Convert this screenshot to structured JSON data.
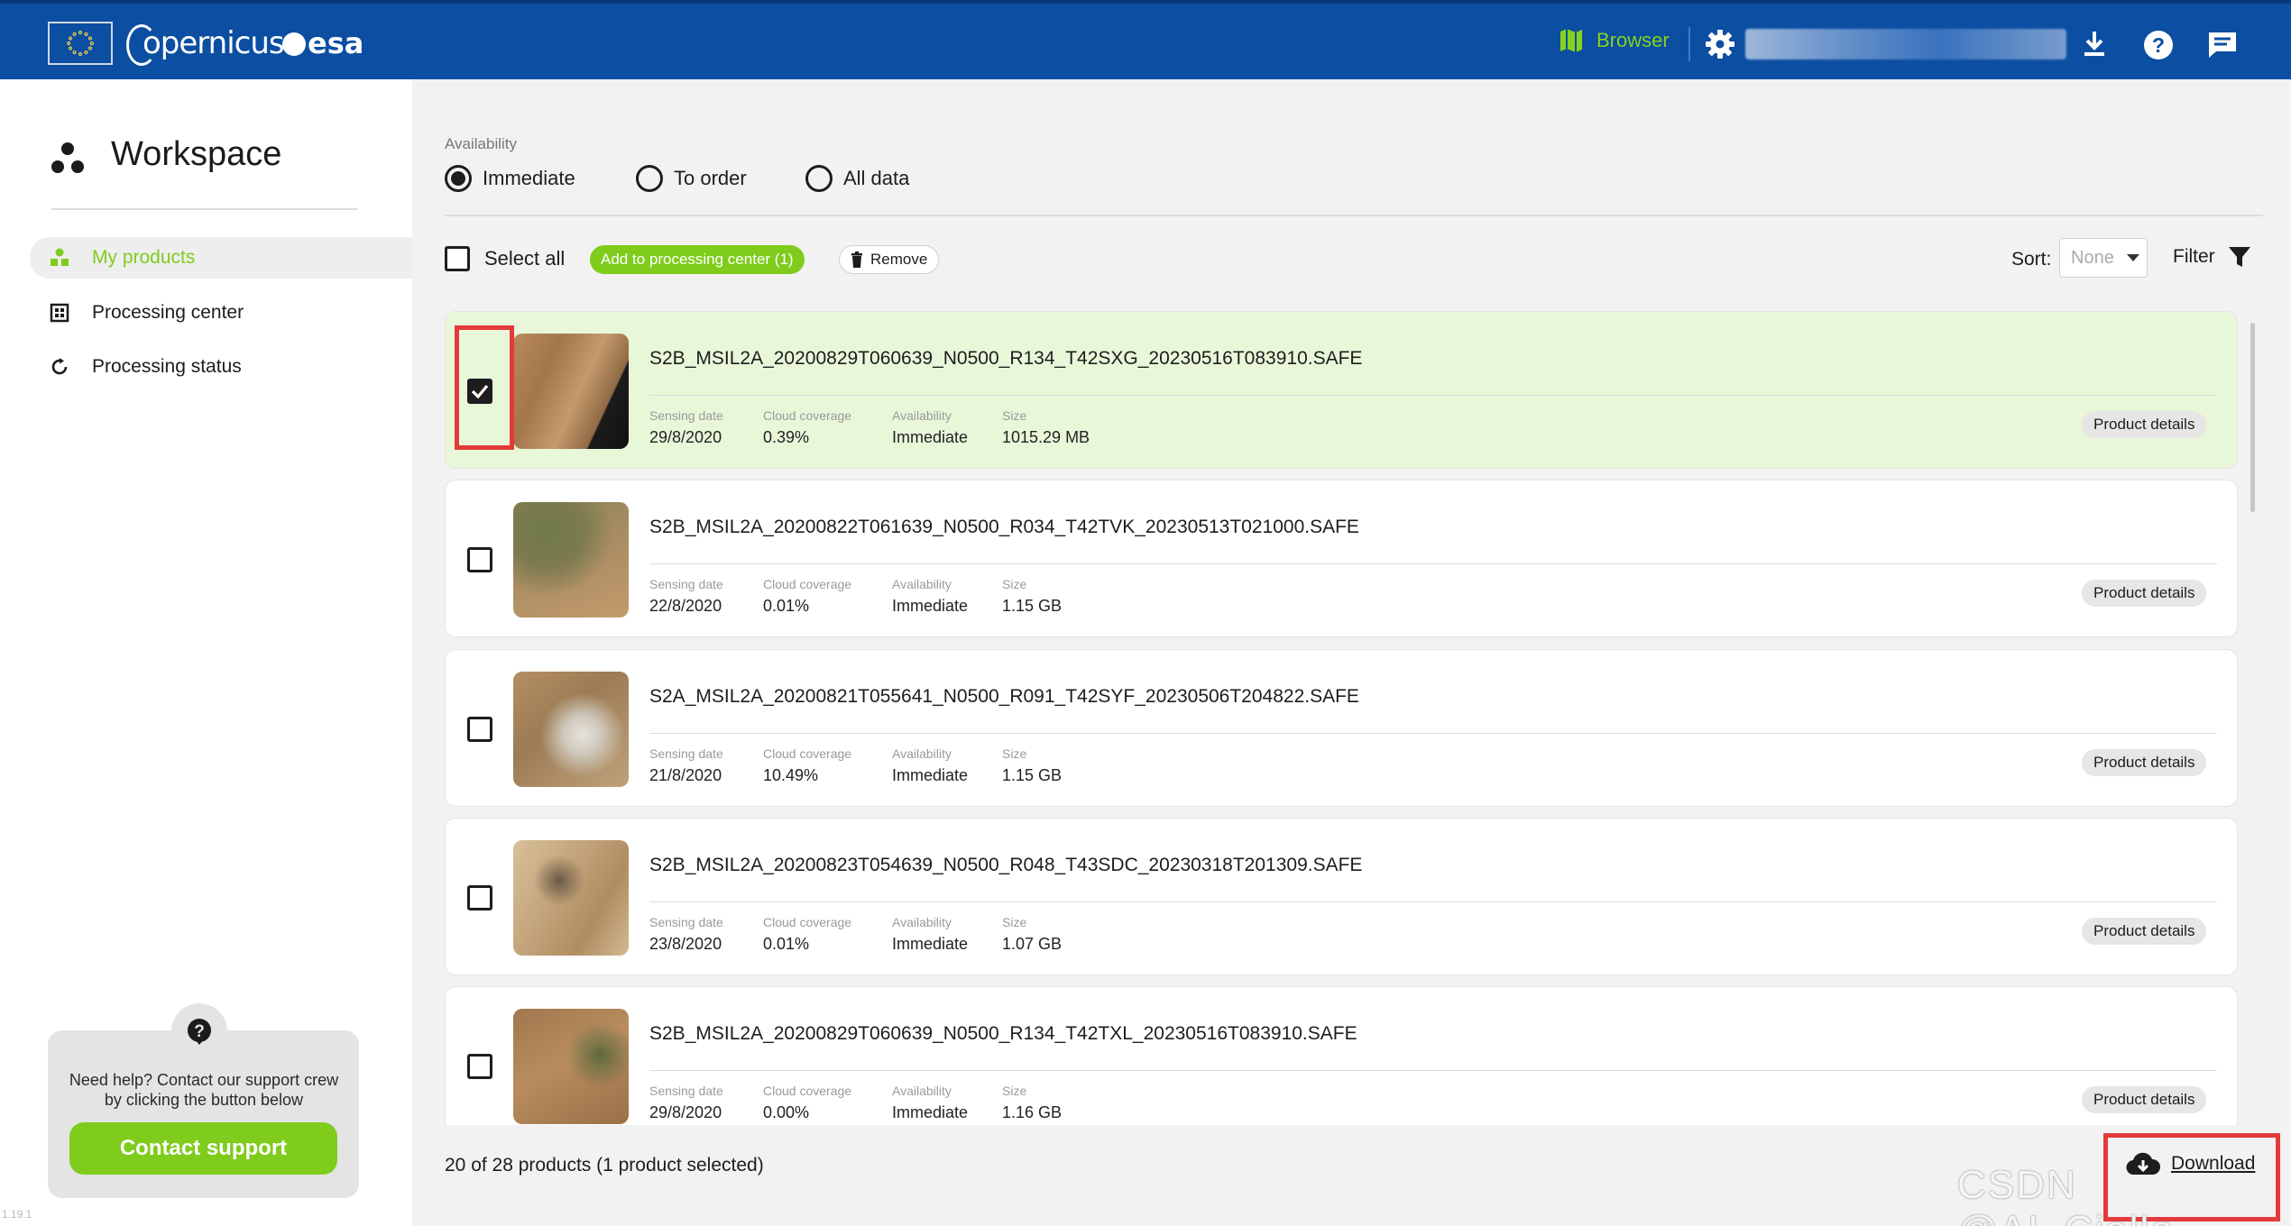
{
  "header": {
    "brand_copernicus": "opernicus",
    "brand_esa": "esa",
    "browser_label": "Browser",
    "accent": "#86d21c",
    "bar_color": "#0b4ea2"
  },
  "sidebar": {
    "title": "Workspace",
    "items": [
      {
        "label": "My products",
        "icon": "products-icon",
        "active": true
      },
      {
        "label": "Processing center",
        "icon": "processing-center-icon",
        "active": false
      },
      {
        "label": "Processing status",
        "icon": "refresh-icon",
        "active": false
      }
    ],
    "help_text": "Need help? Contact our support crew by clicking the button below",
    "contact_label": "Contact support",
    "version": "1.19.1"
  },
  "availability": {
    "label": "Availability",
    "options": [
      "Immediate",
      "To order",
      "All data"
    ],
    "selected": "Immediate"
  },
  "toolbar": {
    "select_all": "Select all",
    "add_processing": "Add to processing center (1)",
    "remove": "Remove",
    "sort_label": "Sort:",
    "sort_value": "None",
    "filter": "Filter"
  },
  "meta_labels": {
    "sensing": "Sensing date",
    "cloud": "Cloud coverage",
    "availability": "Availability",
    "size": "Size",
    "details": "Product details"
  },
  "products": [
    {
      "name": "S2B_MSIL2A_20200829T060639_N0500_R134_T42SXG_20230516T083910.SAFE",
      "sensing_date": "29/8/2020",
      "cloud": "0.39%",
      "availability": "Immediate",
      "size": "1015.29 MB",
      "selected": true
    },
    {
      "name": "S2B_MSIL2A_20200822T061639_N0500_R034_T42TVK_20230513T021000.SAFE",
      "sensing_date": "22/8/2020",
      "cloud": "0.01%",
      "availability": "Immediate",
      "size": "1.15 GB",
      "selected": false
    },
    {
      "name": "S2A_MSIL2A_20200821T055641_N0500_R091_T42SYF_20230506T204822.SAFE",
      "sensing_date": "21/8/2020",
      "cloud": "10.49%",
      "availability": "Immediate",
      "size": "1.15 GB",
      "selected": false
    },
    {
      "name": "S2B_MSIL2A_20200823T054639_N0500_R048_T43SDC_20230318T201309.SAFE",
      "sensing_date": "23/8/2020",
      "cloud": "0.01%",
      "availability": "Immediate",
      "size": "1.07 GB",
      "selected": false
    },
    {
      "name": "S2B_MSIL2A_20200829T060639_N0500_R134_T42TXL_20230516T083910.SAFE",
      "sensing_date": "29/8/2020",
      "cloud": "0.00%",
      "availability": "Immediate",
      "size": "1.16 GB",
      "selected": false
    }
  ],
  "footer": {
    "count_text": "20 of 28 products (1 product selected)",
    "download_label": "Download"
  },
  "watermark": "CSDN @AI_Ciallo"
}
